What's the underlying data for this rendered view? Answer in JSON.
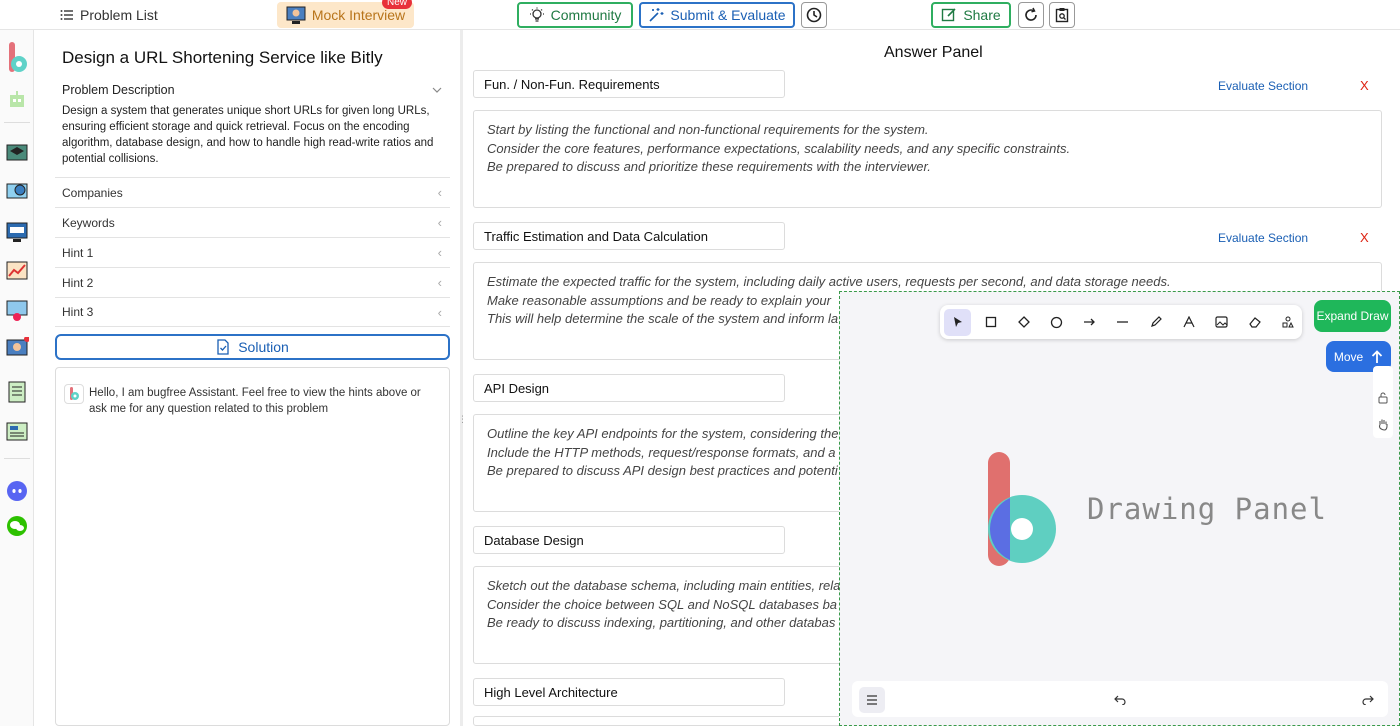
{
  "toolbar": {
    "problem_list": "Problem List",
    "mock_interview": "Mock Interview",
    "new_badge": "New",
    "community": "Community",
    "submit_evaluate": "Submit & Evaluate",
    "share": "Share"
  },
  "problem": {
    "title": "Design a URL Shortening Service like Bitly",
    "description_label": "Problem Description",
    "description": "Design a system that generates unique short URLs for given long URLs, ensuring efficient storage and quick retrieval. Focus on the encoding algorithm, database design, and how to handle high read-write ratios and potential collisions.",
    "accordions": [
      "Companies",
      "Keywords",
      "Hint 1",
      "Hint 2",
      "Hint 3"
    ],
    "solution_label": "Solution"
  },
  "chat": {
    "message": "Hello, I am bugfree Assistant. Feel free to view the hints above or ask me for any question related to this problem"
  },
  "answer_panel": {
    "title": "Answer Panel",
    "evaluate_label": "Evaluate Section",
    "close_label": "X",
    "sections": [
      {
        "title": "Fun. / Non-Fun. Requirements",
        "placeholder": "Start by listing the functional and non-functional requirements for the system.\n Consider the core features, performance expectations, scalability needs, and any specific constraints.\n Be prepared to discuss and prioritize these requirements with the interviewer."
      },
      {
        "title": "Traffic Estimation and Data Calculation",
        "placeholder": "Estimate the expected traffic for the system, including daily active users, requests per second, and data storage needs.\n Make reasonable assumptions and be ready to explain your\n This will help determine the scale of the system and inform la"
      },
      {
        "title": "API Design",
        "placeholder": "Outline the key API endpoints for the system, considering the\n Include the HTTP methods, request/response formats, and a\n Be prepared to discuss API design best practices and potenti"
      },
      {
        "title": "Database Design",
        "placeholder": "Sketch out the database schema, including main entities, rela\n Consider the choice between SQL and NoSQL databases ba\n Be ready to discuss indexing, partitioning, and other databas"
      },
      {
        "title": "High Level Architecture",
        "placeholder": ""
      }
    ]
  },
  "drawing": {
    "label": "Drawing Panel",
    "expand_label": "Expand Draw",
    "move_label": "Move"
  },
  "colors": {
    "accent_blue": "#2c72c7",
    "accent_green": "#2fae60",
    "mock_bg": "#fde7c9",
    "danger_red": "#d21111"
  }
}
